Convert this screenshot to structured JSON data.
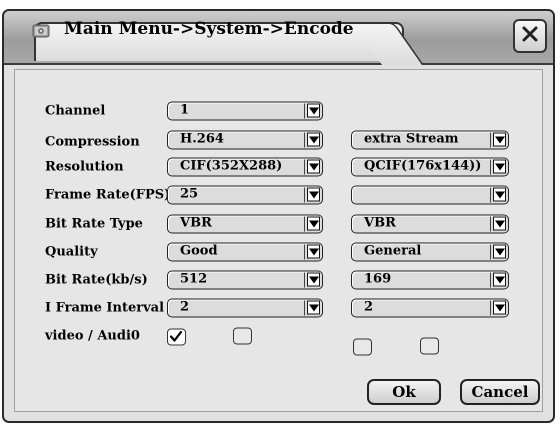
{
  "title": "Main Menu->System->Encode",
  "close_icon": "close-icon",
  "menu_icon": "gear-icon",
  "labels": {
    "channel": "Channel",
    "compression": "Compression",
    "resolution": "Resolution",
    "frame_rate": "Frame Rate(FPS)",
    "bit_rate_type": "Bit Rate Type",
    "quality": "Quality",
    "bit_rate": "Bit Rate(kb/s)",
    "i_frame_interval": "I Frame Interval",
    "video_audio": "video / Audi0"
  },
  "main_stream": {
    "channel": "1",
    "compression": "H.264",
    "resolution": "CIF(352X288)",
    "frame_rate": "25",
    "bit_rate_type": "VBR",
    "quality": "Good",
    "bit_rate": "512",
    "i_frame_interval": "2",
    "video_checked": true,
    "audio_checked": false
  },
  "extra_stream": {
    "stream_type": "extra Stream",
    "resolution": "QCIF(176x144))",
    "frame_rate": "",
    "bit_rate_type": "VBR",
    "quality": "General",
    "bit_rate": "169",
    "i_frame_interval": "2",
    "video_checked": false,
    "audio_checked": false
  },
  "buttons": {
    "ok": "Ok",
    "cancel": "Cancel"
  }
}
